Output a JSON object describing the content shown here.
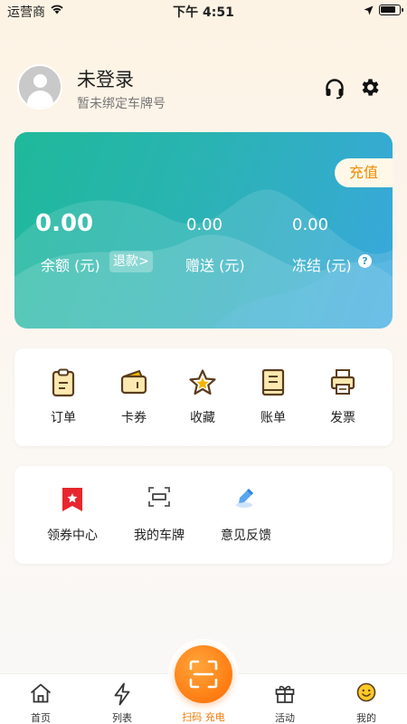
{
  "status_bar": {
    "carrier": "运营商",
    "time": "下午 4:51"
  },
  "profile": {
    "name": "未登录",
    "plate_status": "暂未绑定车牌号"
  },
  "wallet": {
    "recharge_label": "充值",
    "balance_value": "0.00",
    "balance_label": "余额 (元)",
    "refund_label": "退款>",
    "gift_value": "0.00",
    "gift_label": "赠送 (元)",
    "frozen_value": "0.00",
    "frozen_label": "冻结 (元)",
    "help_glyph": "?"
  },
  "orders_menu": [
    {
      "label": "订单",
      "icon": "clipboard-icon"
    },
    {
      "label": "卡券",
      "icon": "coupon-wallet-icon"
    },
    {
      "label": "收藏",
      "icon": "star-icon"
    },
    {
      "label": "账单",
      "icon": "ledger-icon"
    },
    {
      "label": "发票",
      "icon": "printer-icon"
    }
  ],
  "services_menu": [
    {
      "label": "领券中心",
      "icon": "coupon-center-icon"
    },
    {
      "label": "我的车牌",
      "icon": "license-plate-icon"
    },
    {
      "label": "意见反馈",
      "icon": "feedback-icon"
    }
  ],
  "tab_bar": {
    "home": "首页",
    "list": "列表",
    "scan": "扫码 充电",
    "activity": "活动",
    "mine": "我的"
  },
  "colors": {
    "accent_orange": "#ff7c12",
    "wallet_green": "#1fb99a",
    "wallet_blue": "#3aa7de",
    "icon_brown": "#5a3d1e",
    "icon_gold": "#f5b400"
  }
}
